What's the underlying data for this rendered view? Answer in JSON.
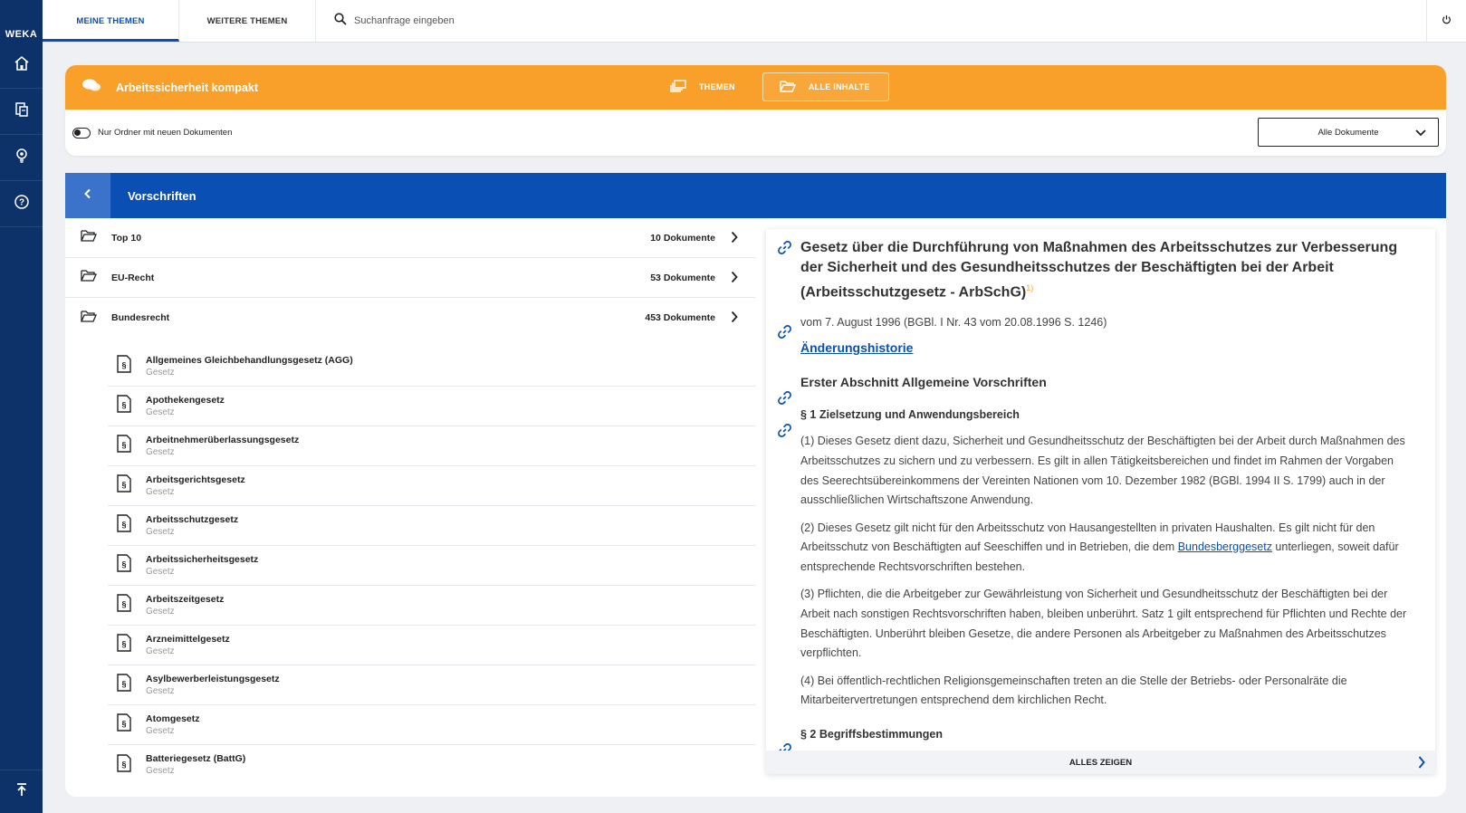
{
  "rail": {
    "logo": "WEKA",
    "items": [
      "home-icon",
      "documents-icon",
      "lightbulb-icon",
      "help-icon"
    ],
    "bottom": "scroll-top-icon"
  },
  "topbar": {
    "tabs": [
      "MEINE THEMEN",
      "WEITERE THEMEN"
    ],
    "active_tab": "MEINE THEMEN",
    "search_placeholder": "Suchanfrage eingeben",
    "power_icon": "power-icon"
  },
  "header": {
    "title": "Arbeitssicherheit kompakt",
    "view_tabs": [
      "THEMEN",
      "ALLE INHALTE"
    ],
    "active_view": "ALLE INHALTE",
    "filter_label": "Nur Ordner mit neuen Dokumenten",
    "select_value": "Alle Dokumente"
  },
  "section": {
    "title": "Vorschriften"
  },
  "folders": [
    {
      "name": "Top 10",
      "count": "10 Dokumente"
    },
    {
      "name": "EU-Recht",
      "count": "53 Dokumente"
    },
    {
      "name": "Bundesrecht",
      "count": "453 Dokumente"
    }
  ],
  "documents": [
    {
      "title": "Allgemeines Gleichbehandlungsgesetz (AGG)",
      "type": "Gesetz"
    },
    {
      "title": "Apothekengesetz",
      "type": "Gesetz"
    },
    {
      "title": "Arbeitnehmerüberlassungsgesetz",
      "type": "Gesetz"
    },
    {
      "title": "Arbeitsgerichtsgesetz",
      "type": "Gesetz"
    },
    {
      "title": "Arbeitsschutzgesetz",
      "type": "Gesetz"
    },
    {
      "title": "Arbeitssicherheitsgesetz",
      "type": "Gesetz"
    },
    {
      "title": "Arbeitszeitgesetz",
      "type": "Gesetz"
    },
    {
      "title": "Arzneimittelgesetz",
      "type": "Gesetz"
    },
    {
      "title": "Asylbewerberleistungsgesetz",
      "type": "Gesetz"
    },
    {
      "title": "Atomgesetz",
      "type": "Gesetz"
    },
    {
      "title": "Batteriegesetz (BattG)",
      "type": "Gesetz"
    }
  ],
  "panel": {
    "title": "Gesetz über die Durchführung von Maßnahmen des Arbeitsschutzes zur Verbesserung der Sicherheit und des Gesundheitsschutzes der Beschäftigten bei der Arbeit (Arbeitsschutzgesetz - ArbSchG)",
    "title_footnote": "1)",
    "meta": "vom 7. August 1996 (BGBl. I Nr. 43 vom 20.08.1996 S. 1246)",
    "history_link": "Änderungshistorie",
    "section_heading": "Erster Abschnitt Allgemeine Vorschriften",
    "paragraph_heading": "§ 1 Zielsetzung und Anwendungsbereich",
    "p1": "(1)  Dieses Gesetz dient dazu, Sicherheit und Gesundheitsschutz der Beschäftigten bei der Arbeit durch Maßnahmen des Arbeitsschutzes zu sichern und zu verbessern. Es gilt in allen Tätigkeitsbereichen und findet im Rahmen der Vorgaben des Seerechtsübereinkommens der Vereinten Nationen vom 10. Dezember 1982 (BGBl. 1994 II S. 1799) auch in der ausschließlichen Wirtschaftszone Anwendung.",
    "p2_before": "(2)  Dieses Gesetz gilt nicht für den Arbeitsschutz von Hausangestellten in privaten Haushalten. Es gilt nicht für den Arbeitsschutz von Beschäftigten auf Seeschiffen und in Betrieben, die dem ",
    "p2_link": "Bundesberggesetz",
    "p2_after": " unterliegen, soweit dafür entsprechende Rechtsvorschriften bestehen.",
    "p3": "(3)  Pflichten, die die Arbeitgeber zur Gewährleistung von Sicherheit und Gesundheitsschutz der Beschäftigten bei der Arbeit nach sonstigen Rechtsvorschriften haben, bleiben unberührt. Satz 1 gilt entsprechend für Pflichten und Rechte der Beschäftigten. Unberührt bleiben Gesetze, die andere Personen als Arbeitgeber zu Maßnahmen des Arbeitsschutzes verpflichten.",
    "p4": "(4)  Bei öffentlich-rechtlichen Religionsgemeinschaften treten an die Stelle der Betriebs- oder Personalräte die Mitarbeitervertretungen entsprechend dem kirchlichen Recht.",
    "next_heading": "§ 2 Begriffsbestimmungen",
    "show_all": "ALLES ZEIGEN"
  },
  "colors": {
    "rail": "#0d3169",
    "accent_blue": "#0a4fb4",
    "orange": "#f9a02b"
  }
}
